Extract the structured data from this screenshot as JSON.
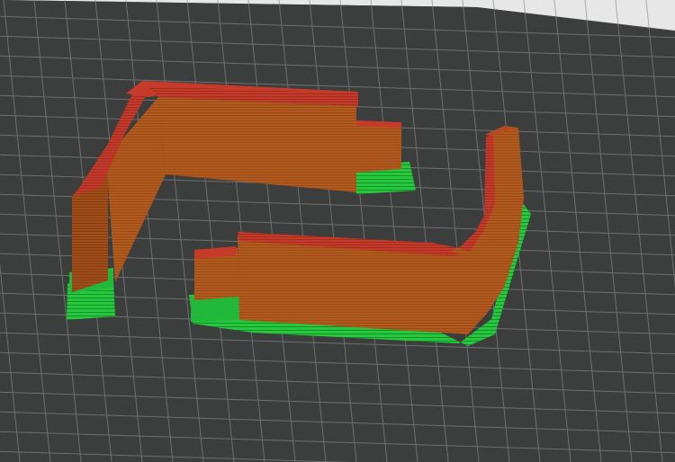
{
  "view": {
    "background": "#4b4c4c",
    "bed_color": "#3a3b3b",
    "grid_line_color": "#8a8b8b",
    "top_backdrop_color": "#e8e8e8"
  },
  "preview": {
    "wall_color": "#b35a1f",
    "wall_shade_color": "#8f4414",
    "overhang_color": "#c93a2a",
    "support_color": "#22c93a",
    "support_dark_color": "#129a26"
  }
}
